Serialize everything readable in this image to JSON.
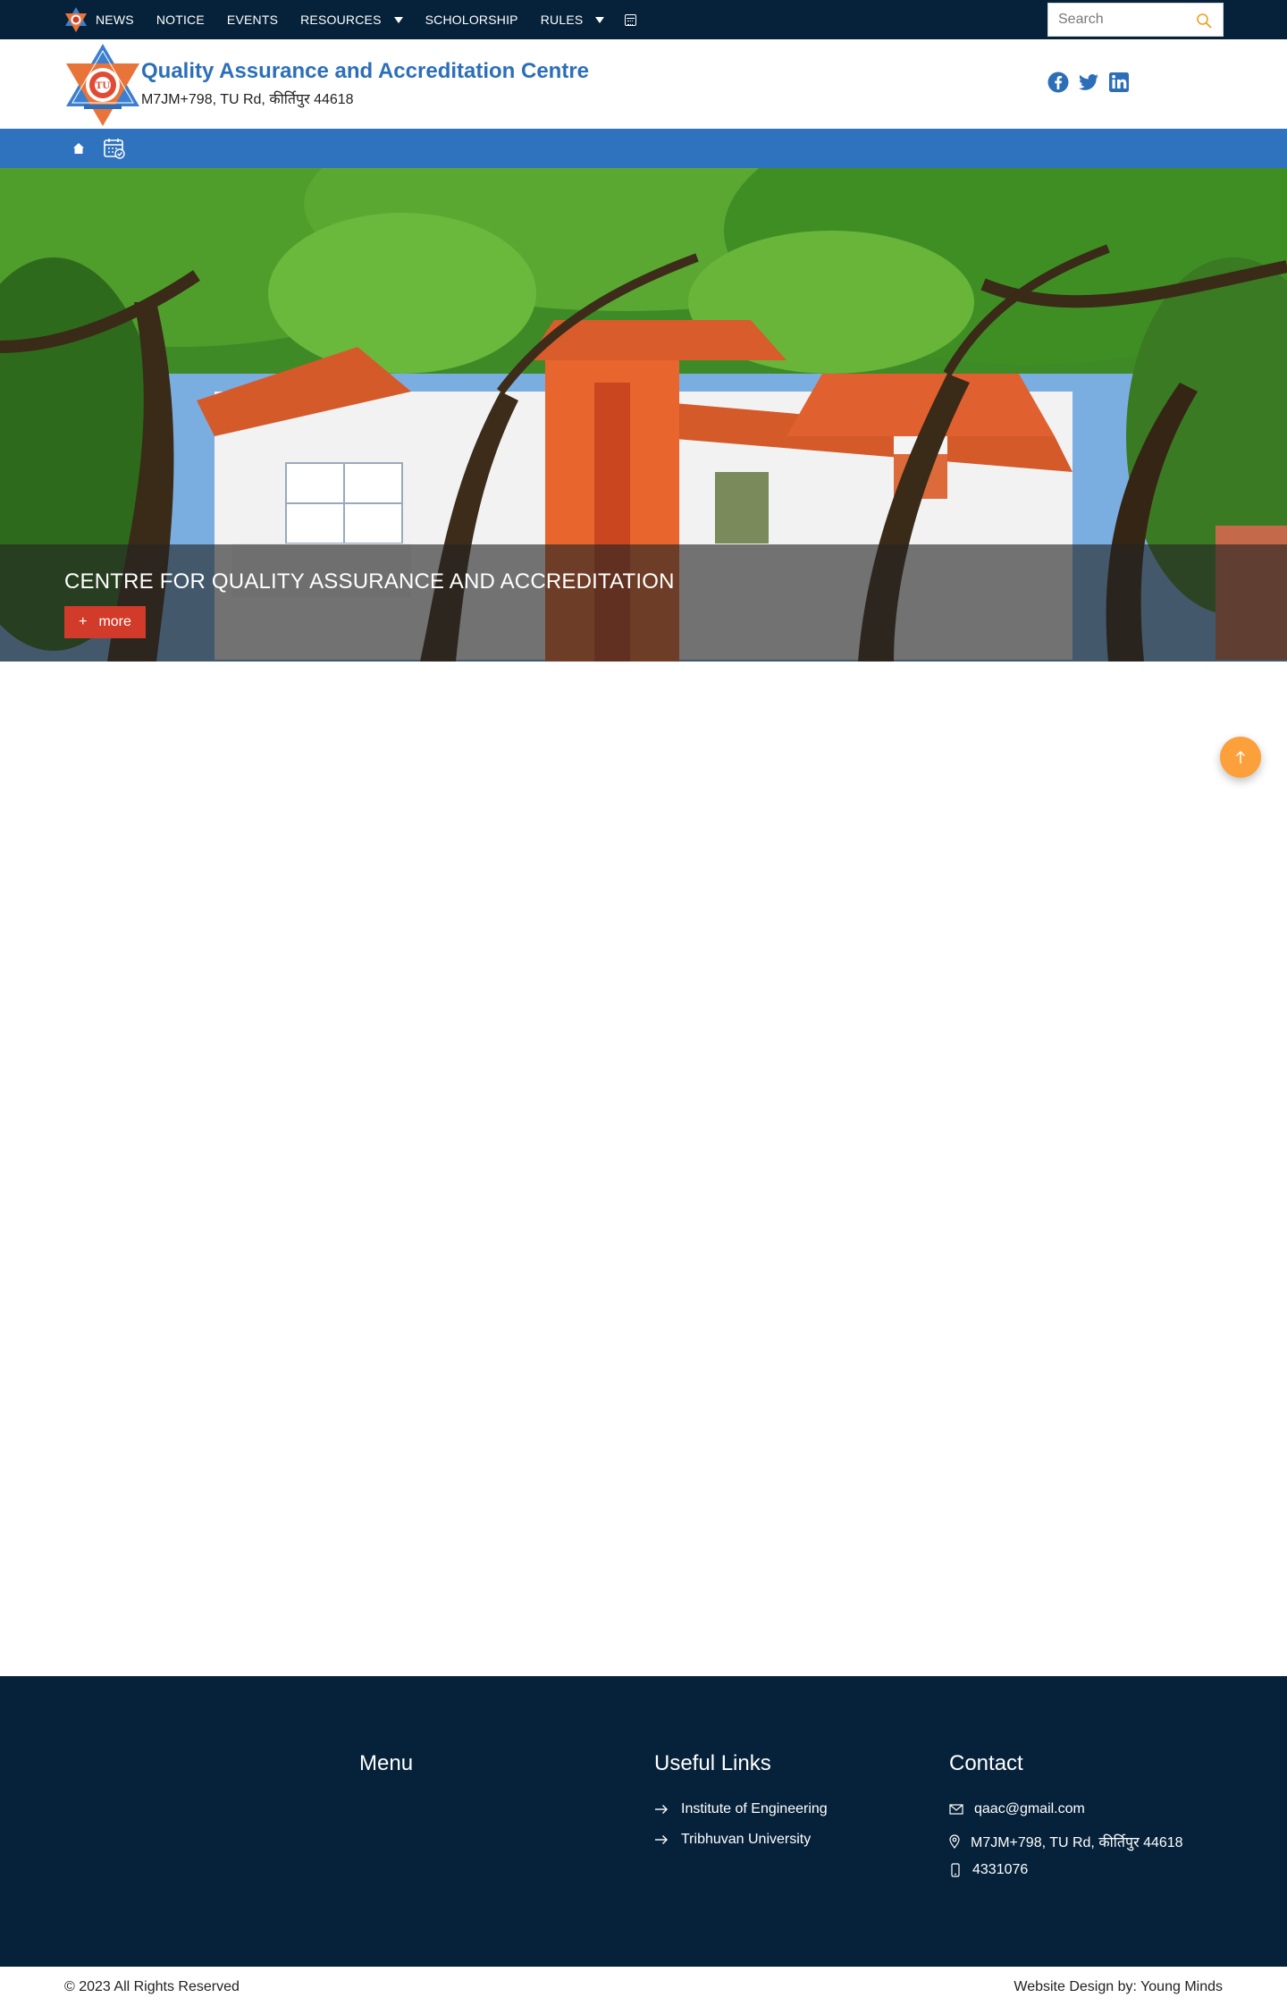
{
  "topnav": {
    "items": [
      {
        "label": "NEWS"
      },
      {
        "label": "NOTICE"
      },
      {
        "label": "EVENTS"
      },
      {
        "label": "RESOURCES"
      },
      {
        "label": "SCHOLORSHIP"
      },
      {
        "label": "RULES"
      }
    ],
    "search_placeholder": "Search"
  },
  "header": {
    "title": "Quality Assurance and Accreditation Centre",
    "address": "M7JM+798, TU Rd, कीर्तिपुर 44618"
  },
  "hero": {
    "title": "CENTRE FOR QUALITY ASSURANCE AND ACCREDITATION",
    "button_label": "more"
  },
  "footer": {
    "menu_title": "Menu",
    "useful_links_title": "Useful Links",
    "useful_links": [
      {
        "label": "Institute of Engineering"
      },
      {
        "label": "Tribhuvan University"
      }
    ],
    "contact_title": "Contact",
    "email": "qaac@gmail.com",
    "address": "M7JM+798, TU Rd, कीर्तिपुर 44618",
    "phone": "4331076"
  },
  "bottom": {
    "copyright": "© 2023 All Rights Reserved",
    "design_by": "Website Design by: Young Minds"
  },
  "colors": {
    "navy": "#06223a",
    "brand_blue": "#2f72be",
    "title_blue": "#2c6fb8",
    "more_red": "#d23a2a",
    "scroll_orange": "#fba03a"
  }
}
